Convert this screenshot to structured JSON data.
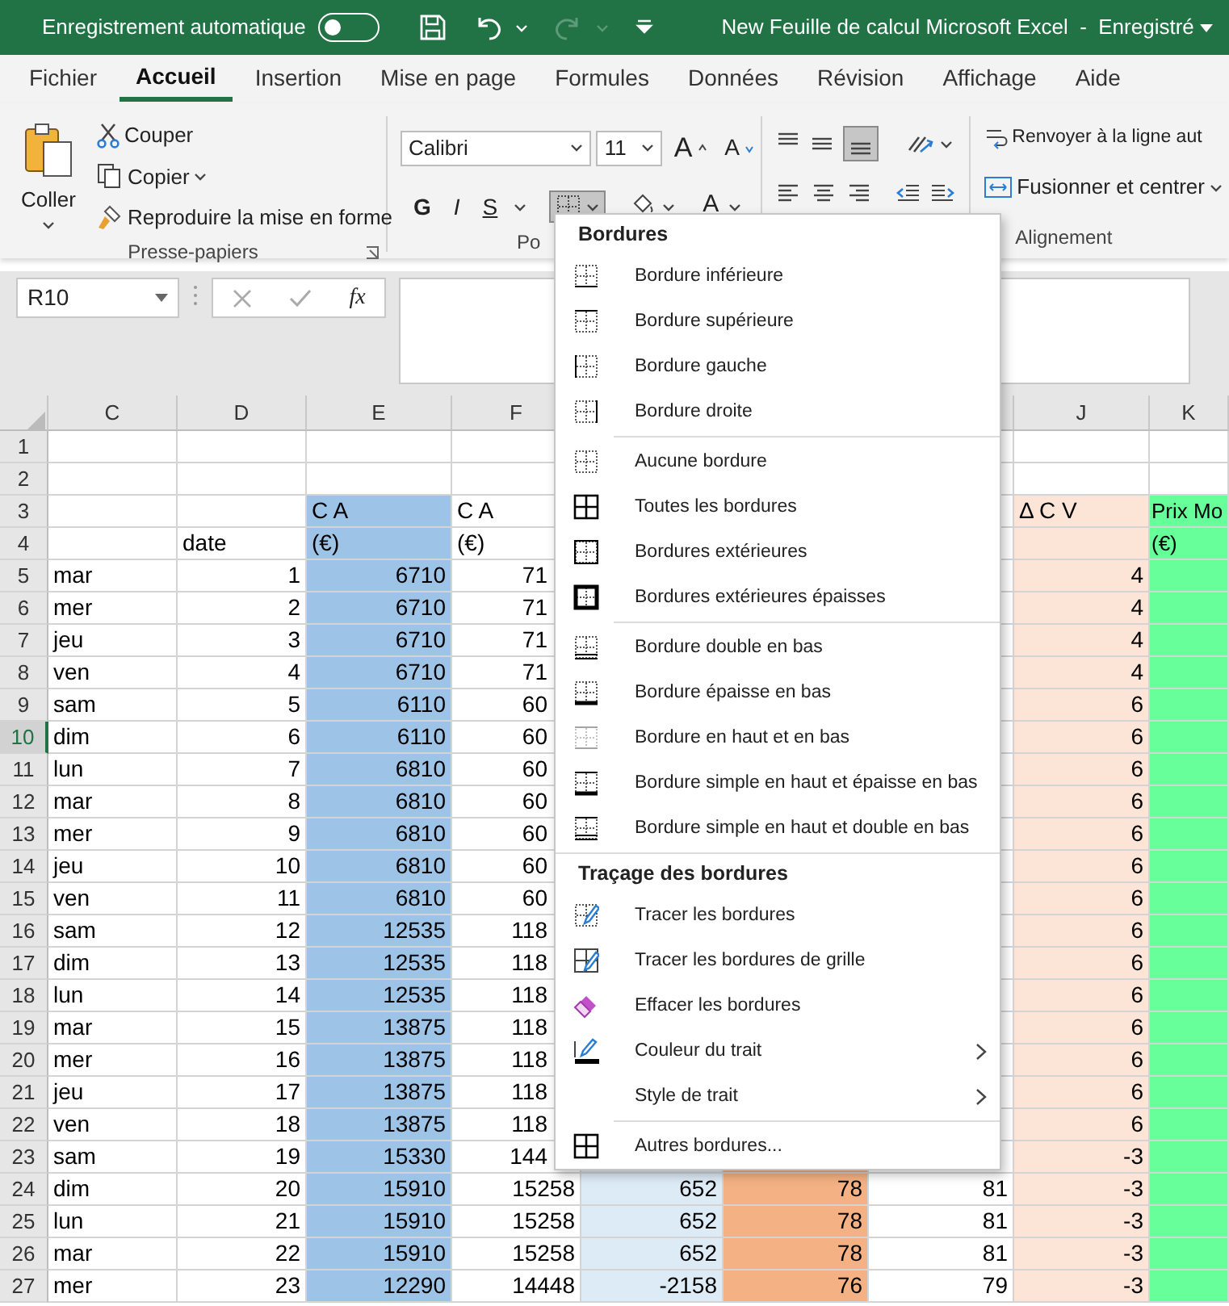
{
  "title_bar": {
    "autosave_label": "Enregistrement automatique",
    "autosave_on": false,
    "document_title": "New Feuille de calcul Microsoft Excel  -  Enregistré"
  },
  "tabs": [
    {
      "label": "Fichier",
      "selected": false
    },
    {
      "label": "Accueil",
      "selected": true
    },
    {
      "label": "Insertion",
      "selected": false
    },
    {
      "label": "Mise en page",
      "selected": false
    },
    {
      "label": "Formules",
      "selected": false
    },
    {
      "label": "Données",
      "selected": false
    },
    {
      "label": "Révision",
      "selected": false
    },
    {
      "label": "Affichage",
      "selected": false
    },
    {
      "label": "Aide",
      "selected": false
    }
  ],
  "ribbon": {
    "clipboard": {
      "paste": "Coller",
      "cut": "Couper",
      "copy": "Copier",
      "format_painter": "Reproduire la mise en forme",
      "label": "Presse-papiers"
    },
    "font": {
      "font_name": "Calibri",
      "font_size": "11",
      "grow_font": "A",
      "shrink_font": "A",
      "bold": "G",
      "italic": "I",
      "underline": "S",
      "borders_pressed": true,
      "font_color": "A",
      "label": "Po"
    },
    "alignment": {
      "wrap_text": "Renvoyer à la ligne aut",
      "merge": "Fusionner et centrer",
      "label": "Alignement"
    }
  },
  "formula_bar": {
    "name_box": "R10",
    "function_label": "fx"
  },
  "sheet": {
    "columns": [
      {
        "letter": "C"
      },
      {
        "letter": "D"
      },
      {
        "letter": "E",
        "color": "#9dc3e6"
      },
      {
        "letter": "F"
      },
      {
        "color": "#ddebf7"
      },
      {
        "color": "#f4b183"
      },
      {},
      {
        "letter": "J",
        "color": "#fce4d6"
      },
      {
        "letter": "K",
        "color": "#66ff99"
      }
    ],
    "rows": [
      {
        "number": "1",
        "selected": false,
        "kind": "blank",
        "cells": []
      },
      {
        "number": "2",
        "selected": false,
        "kind": "blank",
        "cells": []
      },
      {
        "number": "3",
        "selected": false,
        "kind": "label",
        "cells": [
          null,
          null,
          "C A",
          "C A",
          null,
          null,
          null,
          "Δ C V",
          "Prix Mo"
        ]
      },
      {
        "number": "4",
        "selected": false,
        "kind": "label",
        "cells": [
          null,
          "date",
          "(€)",
          "(€)",
          null,
          null,
          null,
          null,
          "(€)"
        ]
      },
      {
        "number": "5",
        "selected": false,
        "kind": "value",
        "cells": [
          "mar",
          "1",
          "6710",
          "71",
          null,
          null,
          null,
          "4"
        ]
      },
      {
        "number": "6",
        "selected": false,
        "kind": "value",
        "cells": [
          "mer",
          "2",
          "6710",
          "71",
          null,
          null,
          null,
          "4"
        ]
      },
      {
        "number": "7",
        "selected": false,
        "kind": "value",
        "cells": [
          "jeu",
          "3",
          "6710",
          "71",
          null,
          null,
          null,
          "4"
        ]
      },
      {
        "number": "8",
        "selected": false,
        "kind": "value",
        "cells": [
          "ven",
          "4",
          "6710",
          "71",
          null,
          null,
          null,
          "4"
        ]
      },
      {
        "number": "9",
        "selected": false,
        "kind": "value",
        "cells": [
          "sam",
          "5",
          "6110",
          "60",
          null,
          null,
          null,
          "6"
        ]
      },
      {
        "number": "10",
        "selected": true,
        "kind": "value",
        "cells": [
          "dim",
          "6",
          "6110",
          "60",
          null,
          null,
          null,
          "6"
        ]
      },
      {
        "number": "11",
        "selected": false,
        "kind": "value",
        "cells": [
          "lun",
          "7",
          "6810",
          "60",
          null,
          null,
          null,
          "6"
        ]
      },
      {
        "number": "12",
        "selected": false,
        "kind": "value",
        "cells": [
          "mar",
          "8",
          "6810",
          "60",
          null,
          null,
          null,
          "6"
        ]
      },
      {
        "number": "13",
        "selected": false,
        "kind": "value",
        "cells": [
          "mer",
          "9",
          "6810",
          "60",
          null,
          null,
          null,
          "6"
        ]
      },
      {
        "number": "14",
        "selected": false,
        "kind": "value",
        "cells": [
          "jeu",
          "10",
          "6810",
          "60",
          null,
          null,
          null,
          "6"
        ]
      },
      {
        "number": "15",
        "selected": false,
        "kind": "value",
        "cells": [
          "ven",
          "11",
          "6810",
          "60",
          null,
          null,
          null,
          "6"
        ]
      },
      {
        "number": "16",
        "selected": false,
        "kind": "value",
        "cells": [
          "sam",
          "12",
          "12535",
          "118",
          null,
          null,
          null,
          "6"
        ]
      },
      {
        "number": "17",
        "selected": false,
        "kind": "value",
        "cells": [
          "dim",
          "13",
          "12535",
          "118",
          null,
          null,
          null,
          "6"
        ]
      },
      {
        "number": "18",
        "selected": false,
        "kind": "value",
        "cells": [
          "lun",
          "14",
          "12535",
          "118",
          null,
          null,
          null,
          "6"
        ]
      },
      {
        "number": "19",
        "selected": false,
        "kind": "value",
        "cells": [
          "mar",
          "15",
          "13875",
          "118",
          null,
          null,
          null,
          "6"
        ]
      },
      {
        "number": "20",
        "selected": false,
        "kind": "value",
        "cells": [
          "mer",
          "16",
          "13875",
          "118",
          null,
          null,
          null,
          "6"
        ]
      },
      {
        "number": "21",
        "selected": false,
        "kind": "value",
        "cells": [
          "jeu",
          "17",
          "13875",
          "118",
          null,
          null,
          null,
          "6"
        ]
      },
      {
        "number": "22",
        "selected": false,
        "kind": "value",
        "cells": [
          "ven",
          "18",
          "13875",
          "118",
          null,
          null,
          null,
          "6"
        ]
      },
      {
        "number": "23",
        "selected": false,
        "kind": "value",
        "cells": [
          "sam",
          "19",
          "15330",
          "144",
          null,
          null,
          null,
          "-3"
        ]
      },
      {
        "number": "24",
        "selected": false,
        "kind": "value",
        "cells": [
          "dim",
          "20",
          "15910",
          "15258",
          "652",
          "78",
          "81",
          "-3"
        ]
      },
      {
        "number": "25",
        "selected": false,
        "kind": "value",
        "cells": [
          "lun",
          "21",
          "15910",
          "15258",
          "652",
          "78",
          "81",
          "-3"
        ]
      },
      {
        "number": "26",
        "selected": false,
        "kind": "value",
        "cells": [
          "mar",
          "22",
          "15910",
          "15258",
          "652",
          "78",
          "81",
          "-3"
        ]
      },
      {
        "number": "27",
        "selected": false,
        "kind": "value",
        "cells": [
          "mer",
          "23",
          "12290",
          "14448",
          "-2158",
          "76",
          "79",
          "-3"
        ]
      }
    ]
  },
  "borders_menu": {
    "sections": [
      {
        "header": "Bordures",
        "groups": [
          [
            {
              "kind": "bottom",
              "label": "Bordure inférieure",
              "submenu": false
            },
            {
              "kind": "top",
              "label": "Bordure supérieure",
              "submenu": false
            },
            {
              "kind": "left",
              "label": "Bordure gauche",
              "submenu": false
            },
            {
              "kind": "right",
              "label": "Bordure droite",
              "submenu": false
            }
          ],
          [
            {
              "kind": "none",
              "label": "Aucune bordure",
              "submenu": false
            },
            {
              "kind": "all",
              "label": "Toutes les bordures",
              "submenu": false
            },
            {
              "kind": "outside",
              "label": "Bordures extérieures",
              "submenu": false
            },
            {
              "kind": "thick_outside",
              "label": "Bordures extérieures épaisses",
              "submenu": false
            }
          ],
          [
            {
              "kind": "double_bottom",
              "label": "Bordure double en bas",
              "submenu": false
            },
            {
              "kind": "thick_bottom",
              "label": "Bordure épaisse en bas",
              "submenu": false
            },
            {
              "kind": "top_bottom",
              "label": "Bordure en haut et en bas",
              "submenu": false
            },
            {
              "kind": "top_thick_bottom",
              "label": "Bordure simple en haut et épaisse en bas",
              "submenu": false
            },
            {
              "kind": "top_double_bottom",
              "label": "Bordure simple en haut et double en bas",
              "submenu": false
            }
          ]
        ]
      },
      {
        "header": "Traçage des bordures",
        "groups": [
          [
            {
              "kind": "draw",
              "label": "Tracer les bordures",
              "submenu": false
            },
            {
              "kind": "draw_grid",
              "label": "Tracer les bordures de grille",
              "submenu": false
            },
            {
              "kind": "erase",
              "label": "Effacer les bordures",
              "submenu": false
            },
            {
              "kind": "line_color",
              "label": "Couleur du trait",
              "submenu": true
            },
            {
              "kind": "text_only",
              "label": "Style de trait",
              "submenu": true
            }
          ],
          [
            {
              "kind": "all",
              "label": "Autres bordures...",
              "submenu": false
            }
          ]
        ]
      }
    ]
  }
}
